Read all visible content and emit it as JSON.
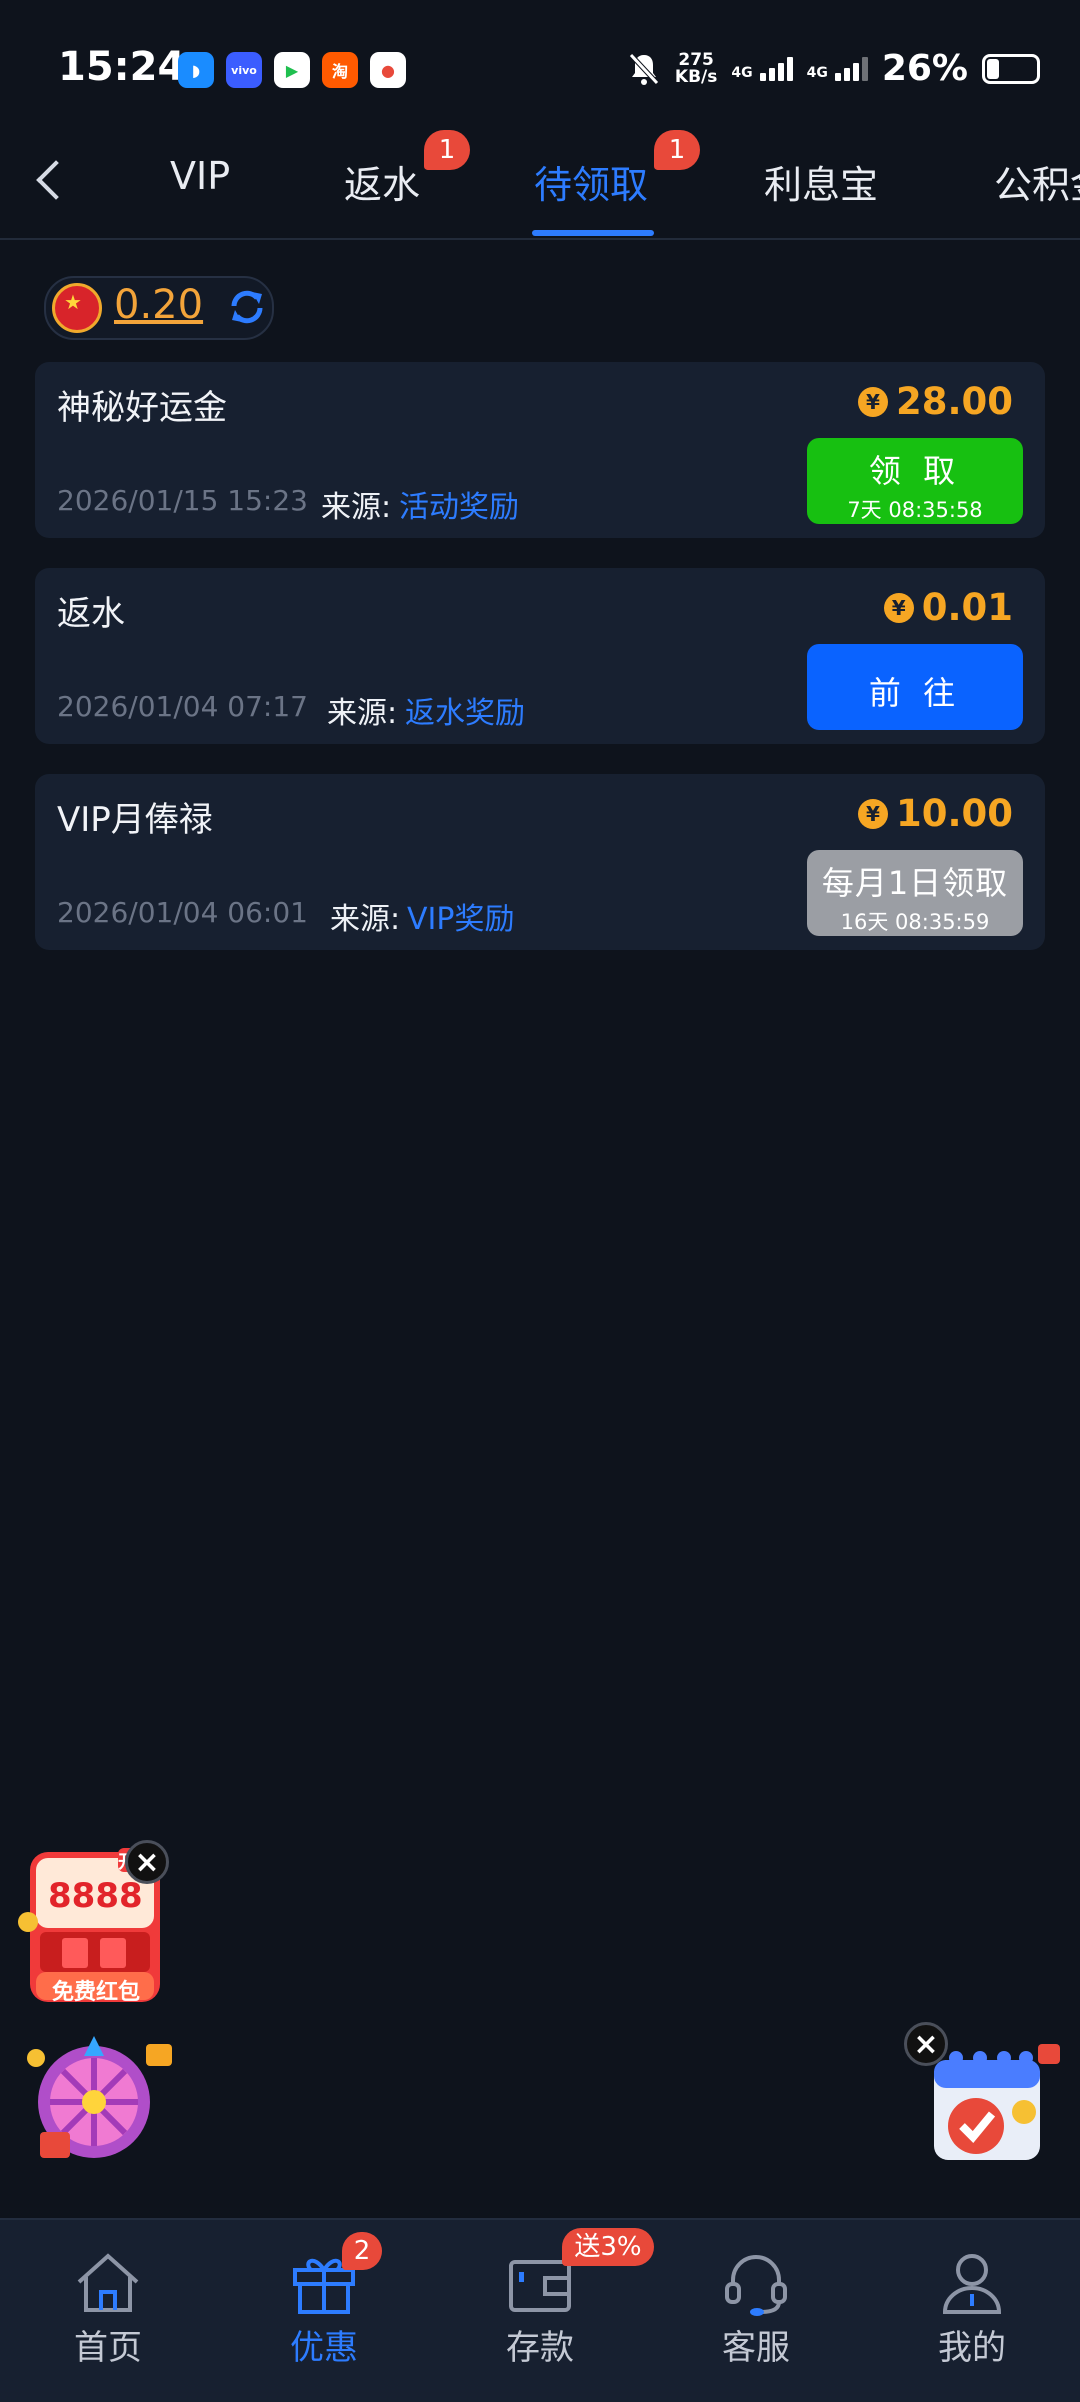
{
  "status_bar": {
    "time": "15:24",
    "net_speed_value": "275",
    "net_speed_unit": "KB/s",
    "sim1": "4G",
    "sim2": "4G",
    "battery": "26%"
  },
  "tabs": [
    {
      "label": "VIP"
    },
    {
      "label": "返水",
      "badge": "1"
    },
    {
      "label": "待领取",
      "badge": "1",
      "active": true
    },
    {
      "label": "利息宝"
    },
    {
      "label": "公积金"
    }
  ],
  "balance": {
    "value": "0.20"
  },
  "cards": [
    {
      "title": "神秘好运金",
      "amount": "28.00",
      "date": "2026/01/15 15:23",
      "source_label": "来源:",
      "source_value": "活动奖励",
      "button_label": "领 取",
      "button_sub": "7天 08:35:58"
    },
    {
      "title": "返水",
      "amount": "0.01",
      "date": "2026/01/04 07:17",
      "source_label": "来源:",
      "source_value": "返水奖励",
      "button_label": "前 往"
    },
    {
      "title": "VIP月俸禄",
      "amount": "10.00",
      "date": "2026/01/04 06:01",
      "source_label": "来源:",
      "source_value": "VIP奖励",
      "button_label": "每月1日领取",
      "button_sub": "16天 08:35:59"
    }
  ],
  "coin_symbol": "¥",
  "floating": {
    "red_packet_amount": "8888",
    "red_packet_label": "免费红包",
    "red_packet_tag": "开"
  },
  "nav": [
    {
      "label": "首页",
      "icon": "home-icon"
    },
    {
      "label": "优惠",
      "icon": "gift-icon",
      "badge": "2",
      "active": true
    },
    {
      "label": "存款",
      "icon": "wallet-icon",
      "badge": "送3%"
    },
    {
      "label": "客服",
      "icon": "headset-icon"
    },
    {
      "label": "我的",
      "icon": "user-icon"
    }
  ],
  "colors": {
    "background": "#0e131c",
    "card": "#172030",
    "accent_blue": "#2d7cff",
    "amount_orange": "#f6a623",
    "claim_green": "#17c011",
    "go_blue": "#0a63ff",
    "disabled_gray": "#9b9ea4",
    "badge_red": "#e8493a"
  }
}
